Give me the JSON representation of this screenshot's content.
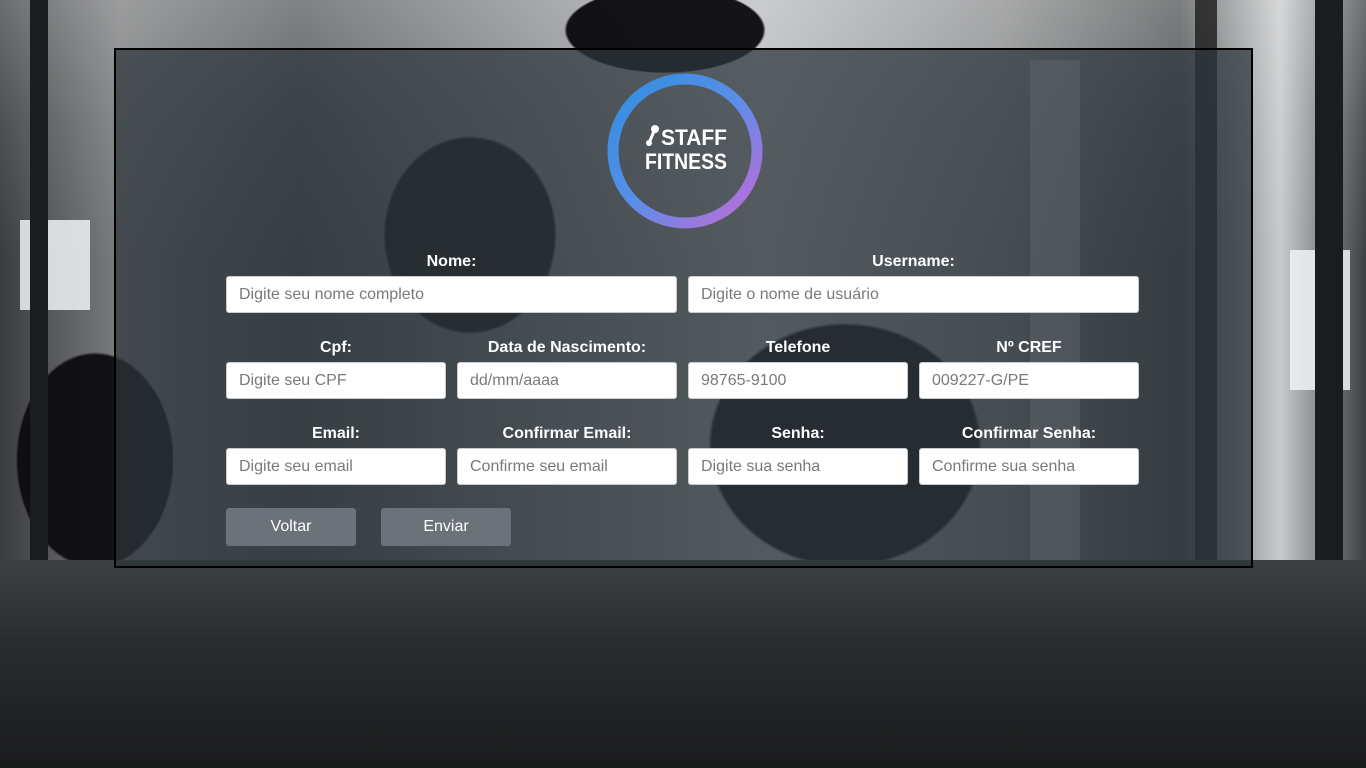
{
  "brand": {
    "logo_line1": "STAFF",
    "logo_line2": "FITNESS"
  },
  "form": {
    "nome": {
      "label": "Nome:",
      "placeholder": "Digite seu nome completo",
      "value": ""
    },
    "username": {
      "label": "Username:",
      "placeholder": "Digite o nome de usuário",
      "value": ""
    },
    "cpf": {
      "label": "Cpf:",
      "placeholder": "Digite seu CPF",
      "value": ""
    },
    "nascimento": {
      "label": "Data de Nascimento:",
      "placeholder": "dd/mm/aaaa",
      "value": ""
    },
    "telefone": {
      "label": "Telefone",
      "placeholder": "98765-9100",
      "value": ""
    },
    "cref": {
      "label": "Nº CREF",
      "placeholder": "009227-G/PE",
      "value": ""
    },
    "email": {
      "label": "Email:",
      "placeholder": "Digite seu email",
      "value": ""
    },
    "confirmar_email": {
      "label": "Confirmar Email:",
      "placeholder": "Confirme seu email",
      "value": ""
    },
    "senha": {
      "label": "Senha:",
      "placeholder": "Digite sua senha",
      "value": ""
    },
    "confirmar_senha": {
      "label": "Confirmar Senha:",
      "placeholder": "Confirme sua senha",
      "value": ""
    }
  },
  "buttons": {
    "voltar": "Voltar",
    "enviar": "Enviar"
  },
  "colors": {
    "button_bg": "#6c7279",
    "logo_ring_start": "#2f8fe0",
    "logo_ring_end": "#c56ad8"
  }
}
